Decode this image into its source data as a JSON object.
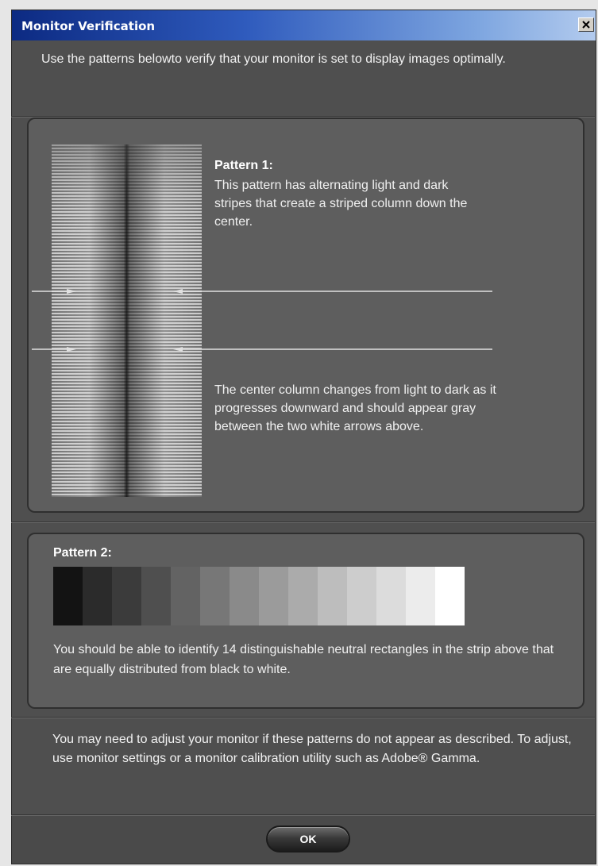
{
  "window": {
    "title": "Monitor Verification",
    "close_icon": "close-icon"
  },
  "intro": "Use the patterns belowto verify that your monitor is set to display images optimally.",
  "pattern1": {
    "title": "Pattern 1:",
    "text": "This pattern has alternating light and dark stripes that create a striped column down the center.",
    "text2": "The center column changes from light to dark as it progresses downward and should appear gray between the two white arrows above."
  },
  "pattern2": {
    "title": "Pattern 2:",
    "swatches": [
      "#131313",
      "#2b2b2b",
      "#3b3b3b",
      "#4f4f4f",
      "#636363",
      "#777777",
      "#8a8a8a",
      "#9b9b9b",
      "#ababab",
      "#bdbdbd",
      "#cdcdcd",
      "#dcdcdc",
      "#ececec",
      "#ffffff"
    ],
    "text": "You should be able to identify 14 distinguishable neutral rectangles in the strip above that are equally distributed from black to white."
  },
  "footer_text": "You may need to adjust your monitor if these patterns do not appear as described. To adjust, use monitor settings or a monitor calibration utility such as Adobe® Gamma.",
  "ok_label": "OK"
}
